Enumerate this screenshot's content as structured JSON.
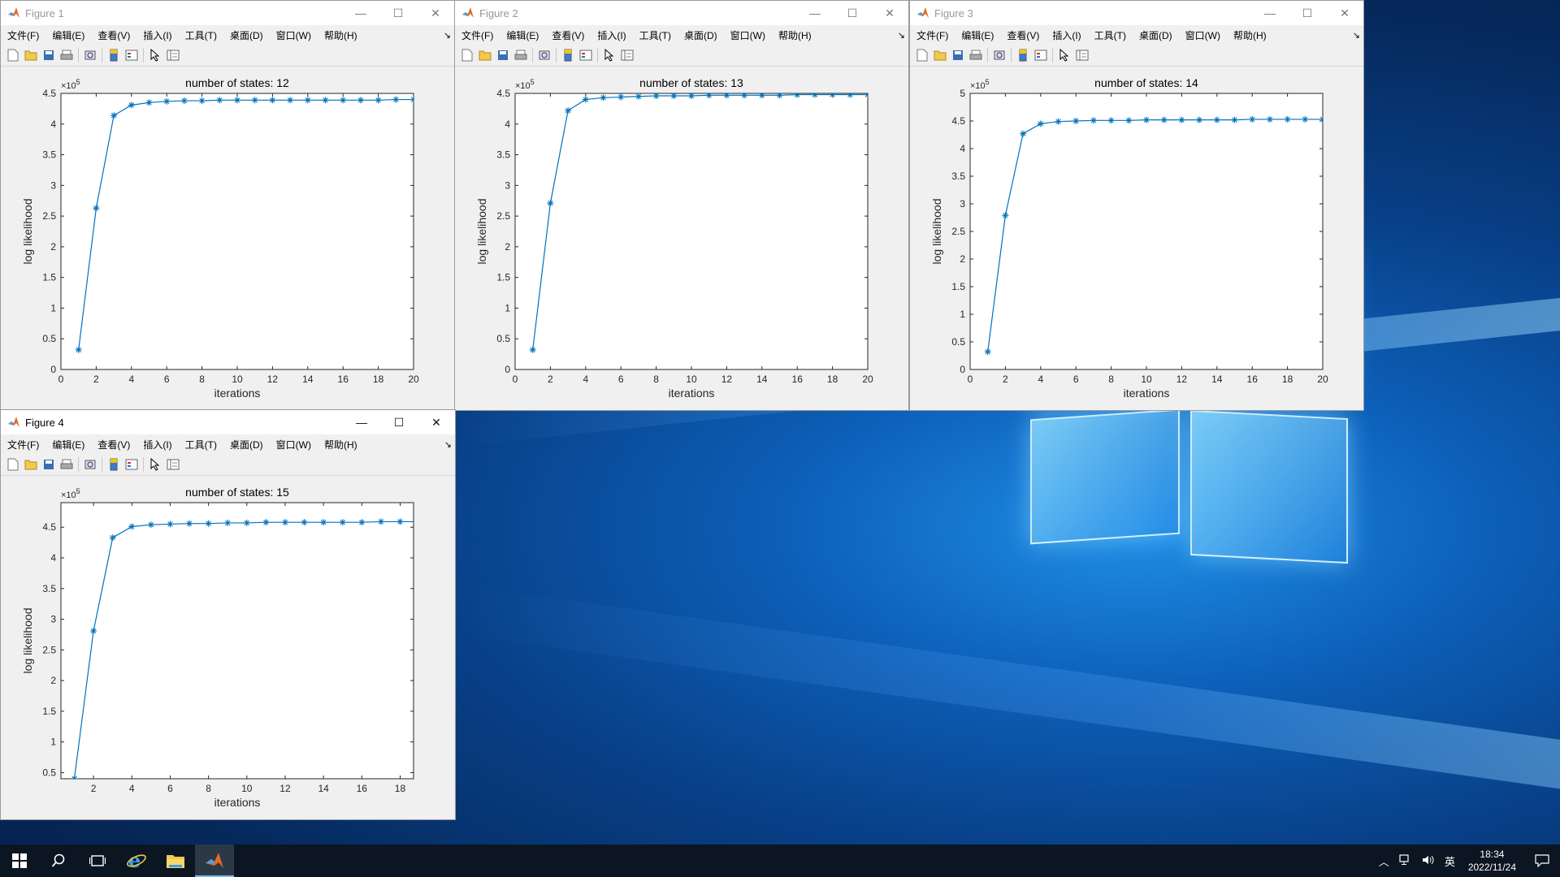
{
  "menus": [
    "文件(F)",
    "编辑(E)",
    "查看(V)",
    "插入(I)",
    "工具(T)",
    "桌面(D)",
    "窗口(W)",
    "帮助(H)"
  ],
  "window_controls": {
    "minimize": "—",
    "maximize": "☐",
    "close": "✕"
  },
  "figures": [
    {
      "title": "Figure 1",
      "chart_data": {
        "type": "line",
        "title": "number of states: 12",
        "xlabel": "iterations",
        "ylabel": "log likelihood",
        "exponent_label": "×10",
        "exponent_power": "5",
        "xlim": [
          0,
          20
        ],
        "ylim": [
          0,
          4.5
        ],
        "xticks": [
          0,
          2,
          4,
          6,
          8,
          10,
          12,
          14,
          16,
          18,
          20
        ],
        "yticks": [
          0,
          0.5,
          1,
          1.5,
          2,
          2.5,
          3,
          3.5,
          4,
          4.5
        ],
        "x": [
          1,
          2,
          3,
          4,
          5,
          6,
          7,
          8,
          9,
          10,
          11,
          12,
          13,
          14,
          15,
          16,
          17,
          18,
          19,
          20
        ],
        "y": [
          0.32,
          2.63,
          4.14,
          4.31,
          4.35,
          4.37,
          4.38,
          4.38,
          4.39,
          4.39,
          4.39,
          4.39,
          4.39,
          4.39,
          4.39,
          4.39,
          4.39,
          4.39,
          4.4,
          4.4
        ],
        "marker": "*",
        "color": "#0072bd"
      }
    },
    {
      "title": "Figure 2",
      "chart_data": {
        "type": "line",
        "title": "number of states: 13",
        "xlabel": "iterations",
        "ylabel": "log likelihood",
        "exponent_label": "×10",
        "exponent_power": "5",
        "xlim": [
          0,
          20
        ],
        "ylim": [
          0,
          4.5
        ],
        "xticks": [
          0,
          2,
          4,
          6,
          8,
          10,
          12,
          14,
          16,
          18,
          20
        ],
        "yticks": [
          0,
          0.5,
          1,
          1.5,
          2,
          2.5,
          3,
          3.5,
          4,
          4.5
        ],
        "x": [
          1,
          2,
          3,
          4,
          5,
          6,
          7,
          8,
          9,
          10,
          11,
          12,
          13,
          14,
          15,
          16,
          17,
          18,
          19,
          20
        ],
        "y": [
          0.32,
          2.71,
          4.22,
          4.4,
          4.43,
          4.44,
          4.45,
          4.46,
          4.46,
          4.46,
          4.47,
          4.47,
          4.47,
          4.47,
          4.47,
          4.48,
          4.48,
          4.48,
          4.48,
          4.48
        ],
        "marker": "*",
        "color": "#0072bd"
      }
    },
    {
      "title": "Figure 3",
      "chart_data": {
        "type": "line",
        "title": "number of states: 14",
        "xlabel": "iterations",
        "ylabel": "log likelihood",
        "exponent_label": "×10",
        "exponent_power": "5",
        "xlim": [
          0,
          20
        ],
        "ylim": [
          0,
          5
        ],
        "xticks": [
          0,
          2,
          4,
          6,
          8,
          10,
          12,
          14,
          16,
          18,
          20
        ],
        "yticks": [
          0,
          0.5,
          1,
          1.5,
          2,
          2.5,
          3,
          3.5,
          4,
          4.5,
          5
        ],
        "x": [
          1,
          2,
          3,
          4,
          5,
          6,
          7,
          8,
          9,
          10,
          11,
          12,
          13,
          14,
          15,
          16,
          17,
          18,
          19,
          20
        ],
        "y": [
          0.32,
          2.79,
          4.27,
          4.45,
          4.49,
          4.5,
          4.51,
          4.51,
          4.51,
          4.52,
          4.52,
          4.52,
          4.52,
          4.52,
          4.52,
          4.53,
          4.53,
          4.53,
          4.53,
          4.53
        ],
        "marker": "*",
        "color": "#0072bd"
      }
    },
    {
      "title": "Figure 4",
      "chart_data": {
        "type": "line",
        "title": "number of states: 15",
        "xlabel": "iterations",
        "ylabel": "log likelihood",
        "exponent_label": "×10",
        "exponent_power": "5",
        "xlim": [
          0.3,
          18.7
        ],
        "ylim": [
          0.4,
          4.9
        ],
        "xticks": [
          2,
          4,
          6,
          8,
          10,
          12,
          14,
          16,
          18
        ],
        "yticks": [
          0.5,
          1,
          1.5,
          2,
          2.5,
          3,
          3.5,
          4,
          4.5
        ],
        "x": [
          1,
          2,
          3,
          4,
          5,
          6,
          7,
          8,
          9,
          10,
          11,
          12,
          13,
          14,
          15,
          16,
          17,
          18,
          19
        ],
        "y": [
          0.4,
          2.81,
          4.33,
          4.51,
          4.54,
          4.55,
          4.56,
          4.56,
          4.57,
          4.57,
          4.58,
          4.58,
          4.58,
          4.58,
          4.58,
          4.58,
          4.59,
          4.59,
          4.59
        ],
        "marker": "*",
        "color": "#0072bd"
      }
    }
  ],
  "taskbar": {
    "time": "18:34",
    "date": "2022/11/24",
    "ime": "英",
    "apps": [
      "start-icon",
      "search-icon",
      "task-view-icon",
      "ie-icon",
      "file-explorer-icon",
      "matlab-icon"
    ]
  }
}
